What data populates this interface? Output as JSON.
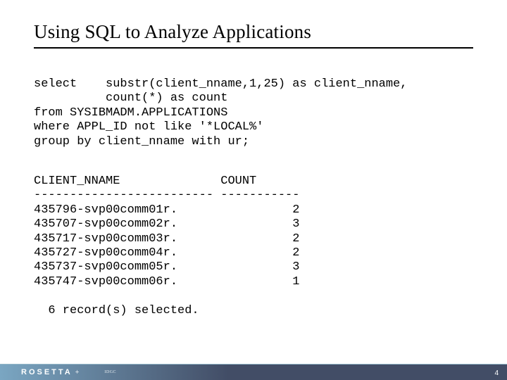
{
  "title": "Using SQL to Analyze Applications",
  "sql": "select    substr(client_nname,1,25) as client_nname,\n          count(*) as count\nfrom SYSIBMADM.APPLICATIONS\nwhere APPL_ID not like '*LOCAL%'\ngroup by client_nname with ur;",
  "result": "CLIENT_NNAME              COUNT\n------------------------- -----------\n435796-svp00comm01r.                2\n435707-svp00comm02r.                3\n435717-svp00comm03r.                2\n435727-svp00comm04r.                2\n435737-svp00comm05r.                3\n435747-svp00comm06r.                1\n\n  6 record(s) selected.",
  "footer": {
    "logo": "ROSETTA",
    "plus": "+",
    "small": "IDGC"
  },
  "slide_number": "4",
  "chart_data": {
    "type": "table",
    "title": "Using SQL to Analyze Applications",
    "sql_query": "select substr(client_nname,1,25) as client_nname, count(*) as count from SYSIBMADM.APPLICATIONS where APPL_ID not like '*LOCAL%' group by client_nname with ur;",
    "columns": [
      "CLIENT_NNAME",
      "COUNT"
    ],
    "rows": [
      {
        "CLIENT_NNAME": "435796-svp00comm01r.",
        "COUNT": 2
      },
      {
        "CLIENT_NNAME": "435707-svp00comm02r.",
        "COUNT": 3
      },
      {
        "CLIENT_NNAME": "435717-svp00comm03r.",
        "COUNT": 2
      },
      {
        "CLIENT_NNAME": "435727-svp00comm04r.",
        "COUNT": 2
      },
      {
        "CLIENT_NNAME": "435737-svp00comm05r.",
        "COUNT": 3
      },
      {
        "CLIENT_NNAME": "435747-svp00comm06r.",
        "COUNT": 1
      }
    ],
    "records_selected": 6
  }
}
